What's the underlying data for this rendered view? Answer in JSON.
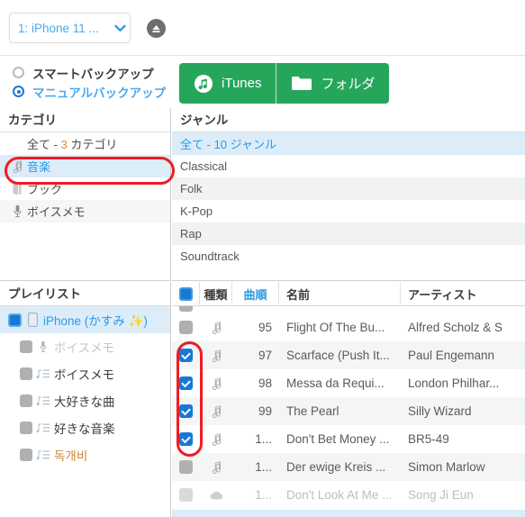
{
  "topbar": {
    "device_label": "1: iPhone 11 ...",
    "chevron_icon": "chevron-down-icon",
    "eject_icon": "eject-icon"
  },
  "backup": {
    "options": [
      {
        "label": "スマートバックアップ",
        "selected": false
      },
      {
        "label": "マニュアルバックアップ",
        "selected": true
      }
    ]
  },
  "source_buttons": [
    {
      "label": "iTunes",
      "icon": "itunes-icon",
      "color": "#26a65b"
    },
    {
      "label": "フォルダ",
      "icon": "folder-icon",
      "color": "#26a65b"
    }
  ],
  "category_panel": {
    "title": "カテゴリ",
    "items": [
      {
        "label_pre": "全て - ",
        "count": "3",
        "label_post": " カテゴリ",
        "icon": "",
        "selected": false,
        "all": true
      },
      {
        "label": "音楽",
        "icon": "music-note-icon",
        "selected": true
      },
      {
        "label": "ブック",
        "icon": "book-icon",
        "selected": false
      },
      {
        "label": "ボイスメモ",
        "icon": "microphone-icon",
        "selected": false
      }
    ]
  },
  "genre_panel": {
    "title": "ジャンル",
    "items": [
      {
        "label_pre": "全て - ",
        "count": "10",
        "label_post": " ジャンル",
        "selected": true,
        "all": true
      },
      {
        "label": "Classical",
        "selected": false
      },
      {
        "label": "Folk",
        "selected": false
      },
      {
        "label": "K-Pop",
        "selected": false
      },
      {
        "label": "Rap",
        "selected": false
      },
      {
        "label": "Soundtrack",
        "selected": false
      }
    ]
  },
  "playlist_panel": {
    "title": "プレイリスト",
    "items": [
      {
        "label": "iPhone (かすみ ✨)",
        "icon": "phone-icon",
        "checked": true,
        "selected": true,
        "indent": 0,
        "dim": false,
        "kr": false
      },
      {
        "label": "ボイスメモ",
        "icon": "microphone-icon",
        "checked": false,
        "selected": false,
        "indent": 1,
        "dim": true,
        "kr": false
      },
      {
        "label": "ボイスメモ",
        "icon": "playlist-icon",
        "checked": false,
        "selected": false,
        "indent": 1,
        "dim": false,
        "kr": false
      },
      {
        "label": "大好きな曲",
        "icon": "playlist-icon",
        "checked": false,
        "selected": false,
        "indent": 1,
        "dim": false,
        "kr": false
      },
      {
        "label": "好きな音楽",
        "icon": "playlist-icon",
        "checked": false,
        "selected": false,
        "indent": 1,
        "dim": false,
        "kr": false
      },
      {
        "label": "독개비",
        "icon": "playlist-icon",
        "checked": false,
        "selected": false,
        "indent": 1,
        "dim": false,
        "kr": true
      }
    ]
  },
  "track_table": {
    "headers": [
      {
        "label": "",
        "key": "checkbox",
        "sorted": false
      },
      {
        "label": "種類",
        "key": "kind",
        "sorted": false
      },
      {
        "label": "曲順",
        "key": "order",
        "sorted": true
      },
      {
        "label": "名前",
        "key": "name",
        "sorted": false
      },
      {
        "label": "アーティスト",
        "key": "artist",
        "sorted": false
      }
    ],
    "select_all_checked": true,
    "rows": [
      {
        "checked": false,
        "kind": "music-note-icon",
        "order": "95",
        "name": "Flight Of The Bu...",
        "artist": "Alfred Scholz & S",
        "dim": false
      },
      {
        "checked": true,
        "kind": "music-note-icon",
        "order": "97",
        "name": "Scarface (Push It...",
        "artist": "Paul Engemann",
        "dim": false
      },
      {
        "checked": true,
        "kind": "music-note-icon",
        "order": "98",
        "name": "Messa da Requi...",
        "artist": "London Philhar...",
        "dim": false
      },
      {
        "checked": true,
        "kind": "music-note-icon",
        "order": "99",
        "name": "The Pearl",
        "artist": "Silly Wizard",
        "dim": false
      },
      {
        "checked": true,
        "kind": "music-note-icon",
        "order": "1...",
        "name": "Don't Bet Money ...",
        "artist": "BR5-49",
        "dim": false
      },
      {
        "checked": false,
        "kind": "music-note-icon",
        "order": "1...",
        "name": "Der ewige Kreis ...",
        "artist": "Simon Marlow",
        "dim": false
      },
      {
        "checked": false,
        "kind": "cloud-icon",
        "order": "1...",
        "name": "Don't Look At Me ...",
        "artist": "Song Ji Eun",
        "dim": true
      }
    ]
  },
  "annotations": [
    {
      "name": "music-category-highlight",
      "color": "#ee1c23"
    },
    {
      "name": "checked-rows-highlight",
      "color": "#ee1c23"
    }
  ]
}
